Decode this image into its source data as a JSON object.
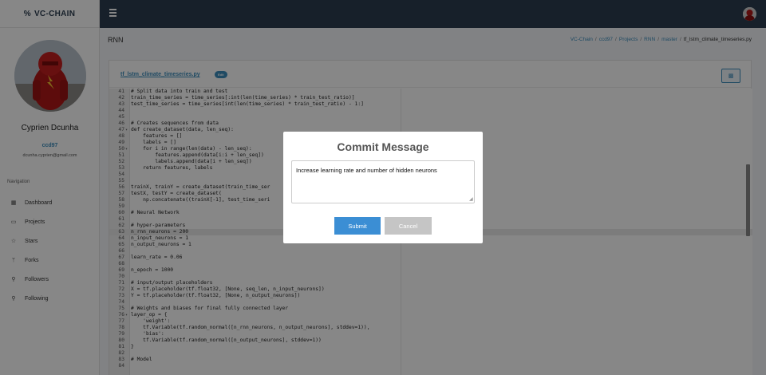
{
  "app": {
    "brand": "VC-CHAIN",
    "brand_icon": "link-icon"
  },
  "user": {
    "name": "Cyprien Dcunha",
    "handle": "ccd97",
    "email": "dcunha.cyprien@gmail.com"
  },
  "sidebar": {
    "nav_heading": "Navigation",
    "items": [
      {
        "label": "Dashboard",
        "icon": "grid-icon",
        "glyph": "▦"
      },
      {
        "label": "Projects",
        "icon": "folder-icon",
        "glyph": "▭"
      },
      {
        "label": "Stars",
        "icon": "star-icon",
        "glyph": "☆"
      },
      {
        "label": "Forks",
        "icon": "fork-icon",
        "glyph": "ᛘ"
      },
      {
        "label": "Followers",
        "icon": "user-icon",
        "glyph": "⚲"
      },
      {
        "label": "Following",
        "icon": "user-icon",
        "glyph": "⚲"
      }
    ]
  },
  "page": {
    "title": "RNN"
  },
  "breadcrumb": {
    "items": [
      "VC-Chain",
      "ccd97",
      "Projects",
      "RNN",
      "master"
    ],
    "current": "tf_lstm_climate_timeseries.py",
    "separator": "/"
  },
  "file": {
    "name": "tf_lstm_climate_timeseries.py",
    "badge": "Edit",
    "save_icon": "floppy-disk-icon"
  },
  "editor": {
    "highlight_line": "63",
    "lines": [
      {
        "n": "41",
        "f": "",
        "t": "# Split data into train and test"
      },
      {
        "n": "42",
        "f": "",
        "t": "train_time_series = time_series[:int(len(time_series) * train_test_ratio)]"
      },
      {
        "n": "43",
        "f": "",
        "t": "test_time_series = time_series[int(len(time_series) * train_test_ratio) - 1:]"
      },
      {
        "n": "44",
        "f": "",
        "t": ""
      },
      {
        "n": "45",
        "f": "",
        "t": ""
      },
      {
        "n": "46",
        "f": "",
        "t": "# Creates sequences from data"
      },
      {
        "n": "47",
        "f": "▾",
        "t": "def create_dataset(data, len_seq):"
      },
      {
        "n": "48",
        "f": "",
        "t": "    features = []"
      },
      {
        "n": "49",
        "f": "",
        "t": "    labels = []"
      },
      {
        "n": "50",
        "f": "▾",
        "t": "    for i in range(len(data) - len_seq):"
      },
      {
        "n": "51",
        "f": "",
        "t": "        features.append(data[i:i + len_seq])"
      },
      {
        "n": "52",
        "f": "",
        "t": "        labels.append(data[i + len_seq])"
      },
      {
        "n": "53",
        "f": "",
        "t": "    return features, labels"
      },
      {
        "n": "54",
        "f": "",
        "t": ""
      },
      {
        "n": "55",
        "f": "",
        "t": ""
      },
      {
        "n": "56",
        "f": "",
        "t": "trainX, trainY = create_dataset(train_time_ser"
      },
      {
        "n": "57",
        "f": "",
        "t": "testX, testY = create_dataset("
      },
      {
        "n": "58",
        "f": "",
        "t": "    np.concatenate((trainX[-1], test_time_seri"
      },
      {
        "n": "59",
        "f": "",
        "t": ""
      },
      {
        "n": "60",
        "f": "",
        "t": "# Neural Network"
      },
      {
        "n": "61",
        "f": "",
        "t": ""
      },
      {
        "n": "62",
        "f": "",
        "t": "# hyper-parameters"
      },
      {
        "n": "63",
        "f": "",
        "t": "n_rnn_neurons = 200"
      },
      {
        "n": "64",
        "f": "",
        "t": "n_input_neurons = 1"
      },
      {
        "n": "65",
        "f": "",
        "t": "n_output_neurons = 1"
      },
      {
        "n": "66",
        "f": "",
        "t": ""
      },
      {
        "n": "67",
        "f": "",
        "t": "learn_rate = 0.06"
      },
      {
        "n": "68",
        "f": "",
        "t": ""
      },
      {
        "n": "69",
        "f": "",
        "t": "n_epoch = 1000"
      },
      {
        "n": "70",
        "f": "",
        "t": ""
      },
      {
        "n": "71",
        "f": "",
        "t": "# input/output placeholders"
      },
      {
        "n": "72",
        "f": "",
        "t": "X = tf.placeholder(tf.float32, [None, seq_len, n_input_neurons])"
      },
      {
        "n": "73",
        "f": "",
        "t": "Y = tf.placeholder(tf.float32, [None, n_output_neurons])"
      },
      {
        "n": "74",
        "f": "",
        "t": ""
      },
      {
        "n": "75",
        "f": "",
        "t": "# Weights and biases for final fully connected layer"
      },
      {
        "n": "76",
        "f": "▾",
        "t": "layer_op = {"
      },
      {
        "n": "77",
        "f": "",
        "t": "    'weight':"
      },
      {
        "n": "78",
        "f": "",
        "t": "    tf.Variable(tf.random_normal([n_rnn_neurons, n_output_neurons], stddev=1)),"
      },
      {
        "n": "79",
        "f": "",
        "t": "    'bias':"
      },
      {
        "n": "80",
        "f": "",
        "t": "    tf.Variable(tf.random_normal([n_output_neurons], stddev=1))"
      },
      {
        "n": "81",
        "f": "",
        "t": "}"
      },
      {
        "n": "82",
        "f": "",
        "t": ""
      },
      {
        "n": "83",
        "f": "",
        "t": "# Model"
      },
      {
        "n": "84",
        "f": "",
        "t": ""
      }
    ]
  },
  "modal": {
    "title": "Commit Message",
    "message": "Increase learning rate and number of hidden neurons",
    "submit_label": "Submit",
    "cancel_label": "Cancel"
  },
  "colors": {
    "topbar": "#2c3e50",
    "accent": "#3c8dbc",
    "submit": "#3b8ed4",
    "cancel": "#c5c5c5"
  }
}
